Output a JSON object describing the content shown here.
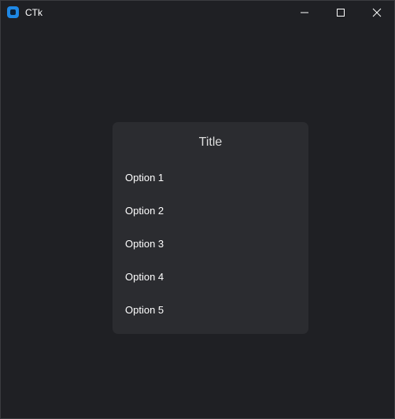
{
  "window": {
    "title": "CTk"
  },
  "icons": {
    "app": "ctk-app-icon",
    "minimize": "minimize-icon",
    "maximize": "maximize-icon",
    "close": "close-icon"
  },
  "colors": {
    "background": "#1f2024",
    "card": "#2b2c30",
    "title_text": "#dcdcdc",
    "option_text": "#ffffff",
    "app_icon": "#1e88e5"
  },
  "card": {
    "title": "Title",
    "options": [
      "Option 1",
      "Option 2",
      "Option 3",
      "Option 4",
      "Option 5"
    ]
  }
}
